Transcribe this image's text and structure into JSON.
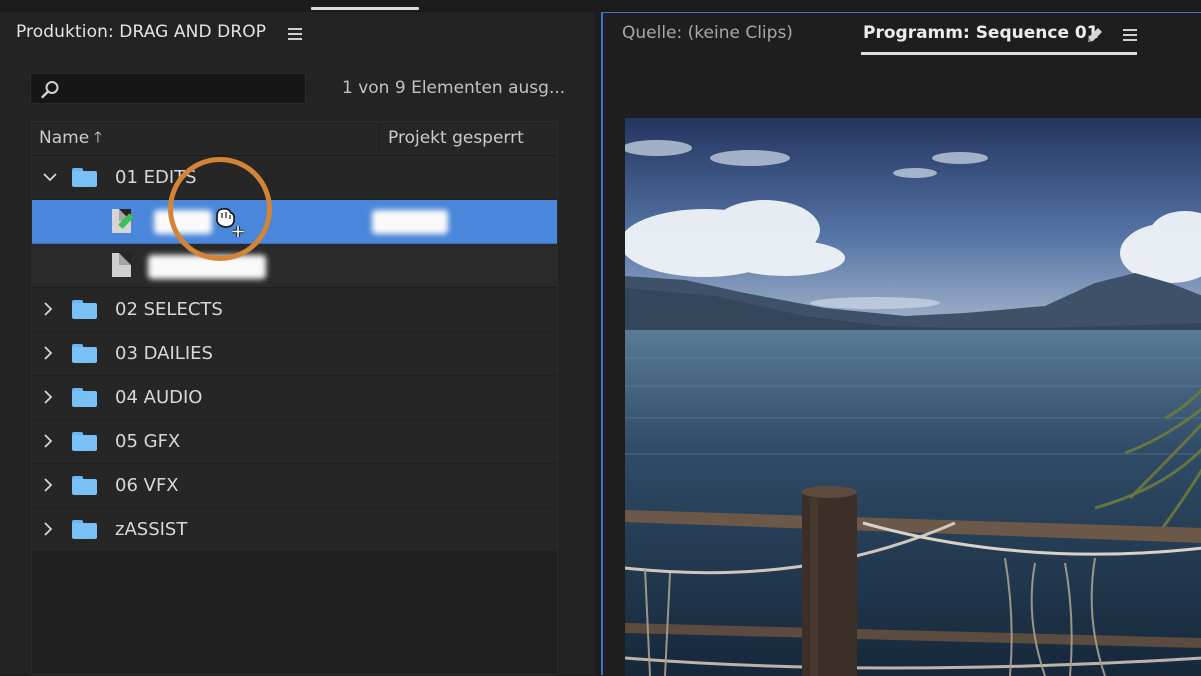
{
  "project_panel": {
    "title": "Produktion: DRAG AND DROP",
    "search_placeholder": "",
    "count": "1 von 9 Elementen ausg...",
    "columns": {
      "name": "Name",
      "sort_arrow": "🡑",
      "locked": "Projekt gesperrt"
    },
    "items": [
      {
        "label": "01 EDITS",
        "expanded": true
      },
      {
        "label": "02 SELECTS"
      },
      {
        "label": "03 DAILIES"
      },
      {
        "label": "04 AUDIO"
      },
      {
        "label": "05 GFX"
      },
      {
        "label": "06 VFX"
      },
      {
        "label": "zASSIST"
      }
    ]
  },
  "monitor": {
    "source_tab": "Quelle: (keine Clips)",
    "program_tab": "Programm: Sequence 01"
  },
  "colors": {
    "selection": "#4a86d9",
    "folder": "#79c0f7",
    "cursor_ring": "#d38436",
    "panel_focus": "#3a74d0"
  },
  "icons": [
    "hamburger-menu-icon",
    "search-icon",
    "sort-up-icon",
    "chevron-down-icon",
    "chevron-right-icon",
    "folder-icon",
    "sequence-icon",
    "document-icon",
    "drag-hand-icon",
    "pencil-icon"
  ]
}
